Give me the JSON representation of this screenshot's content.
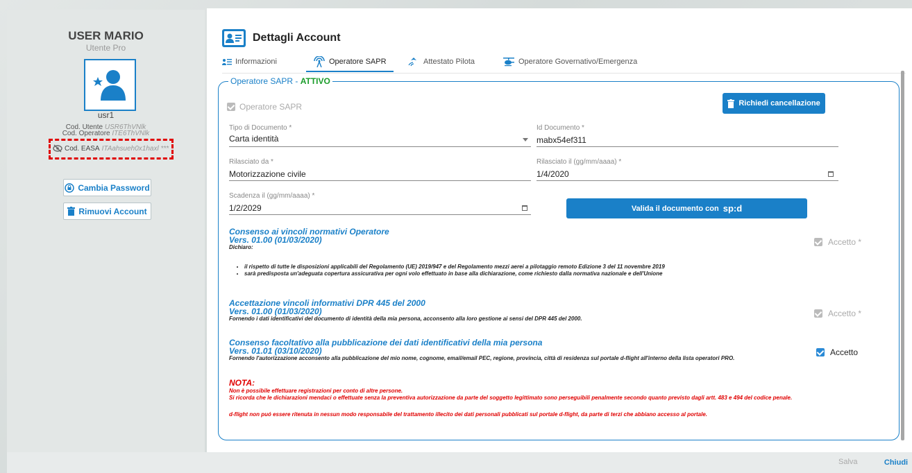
{
  "user": {
    "name": "USER MARIO",
    "role": "Utente Pro",
    "username": "usr1",
    "cod_utente_label": "Cod. Utente",
    "cod_utente_value": "USR6ThVNlk",
    "cod_operatore_label": "Cod. Operatore",
    "cod_operatore_value": "ITE6ThVNlk",
    "cod_easa_label": "Cod. EASA",
    "cod_easa_value": "ITAahsueh0x1haxl ***"
  },
  "sidebar_buttons": {
    "change_password": "Cambia Password",
    "remove_account": "Rimuovi Account"
  },
  "page": {
    "title": "Dettagli Account",
    "tabs": [
      {
        "label": "Informazioni"
      },
      {
        "label": "Operatore SAPR"
      },
      {
        "label": "Attestato Pilota"
      },
      {
        "label": "Operatore Governativo/Emergenza"
      }
    ]
  },
  "sapr": {
    "legend_prefix": "Operatore SAPR - ",
    "legend_status": "ATTIVO",
    "operator_checkbox": "Operatore SAPR",
    "request_delete": "Richiedi cancellazione",
    "doc_type_label": "Tipo di Documento *",
    "doc_type_value": "Carta identità",
    "doc_id_label": "Id Documento *",
    "doc_id_value": "mabx54ef311",
    "issued_by_label": "Rilasciato da *",
    "issued_by_value": "Motorizzazione civile",
    "issued_on_label": "Rilasciato il (gg/mm/aaaa) *",
    "issued_on_value": "1/4/2020",
    "expiry_label": "Scadenza il (gg/mm/aaaa) *",
    "expiry_value": "1/2/2029",
    "spid_button_prefix": "Valida il documento con",
    "spid_brand": "sp:d"
  },
  "consents": [
    {
      "title": "Consenso ai vincoli normativi Operatore",
      "version": "Vers. 01.00 (01/03/2020)",
      "intro": "Dichiaro:",
      "bullets": [
        "il rispetto di tutte le disposizioni applicabili del Regolamento (UE) 2019/947 e del Regolamento mezzi aerei a pilotaggio remoto Edizione 3 del 11 novembre 2019",
        "sarà predisposta un'adeguata copertura assicurativa per ogni volo effettuato in base alla dichiarazione, come richiesto dalla normativa nazionale e dell'Unione"
      ],
      "accept": "Accetto *"
    },
    {
      "title": "Accettazione vincoli informativi DPR 445 del 2000",
      "version": "Vers. 01.00 (01/03/2020)",
      "text": "Fornendo i dati identificativi del documento di identità della mia persona, acconsento alla loro gestione ai sensi del DPR 445 del 2000.",
      "accept": "Accetto *"
    },
    {
      "title": "Consenso facoltativo alla pubblicazione dei dati identificativi della mia persona",
      "version": "Vers. 01.01 (03/10/2020)",
      "text": "Fornendo l'autorizzazione acconsento alla pubblicazione del mio nome, cognome, email/email PEC, regione, provincia, città di residenza sul portale d-flight all'interno della lista operatori PRO.",
      "accept": "Accetto"
    }
  ],
  "nota": {
    "title": "NOTA:",
    "line1": "Non è possibile effettuare registrazioni per conto di altre persone.",
    "line2": "Si ricorda che le dichiarazioni mendaci o effettuate senza la preventiva autorizzazione da parte del soggetto legittimato sono perseguibili penalmente secondo quanto previsto dagli artt. 483 e 494 del codice penale.",
    "line3": "d-flight non puó essere ritenuta in nessun modo responsabile del trattamento illecito dei dati personali pubblicati sul portale d-flight, da parte di terzi che abbiano accesso al portale."
  },
  "footer": {
    "save": "Salva",
    "close": "Chiudi"
  },
  "colors": {
    "accent": "#1a80c8",
    "active_status": "#1a9c2a",
    "warning": "#e00000"
  }
}
